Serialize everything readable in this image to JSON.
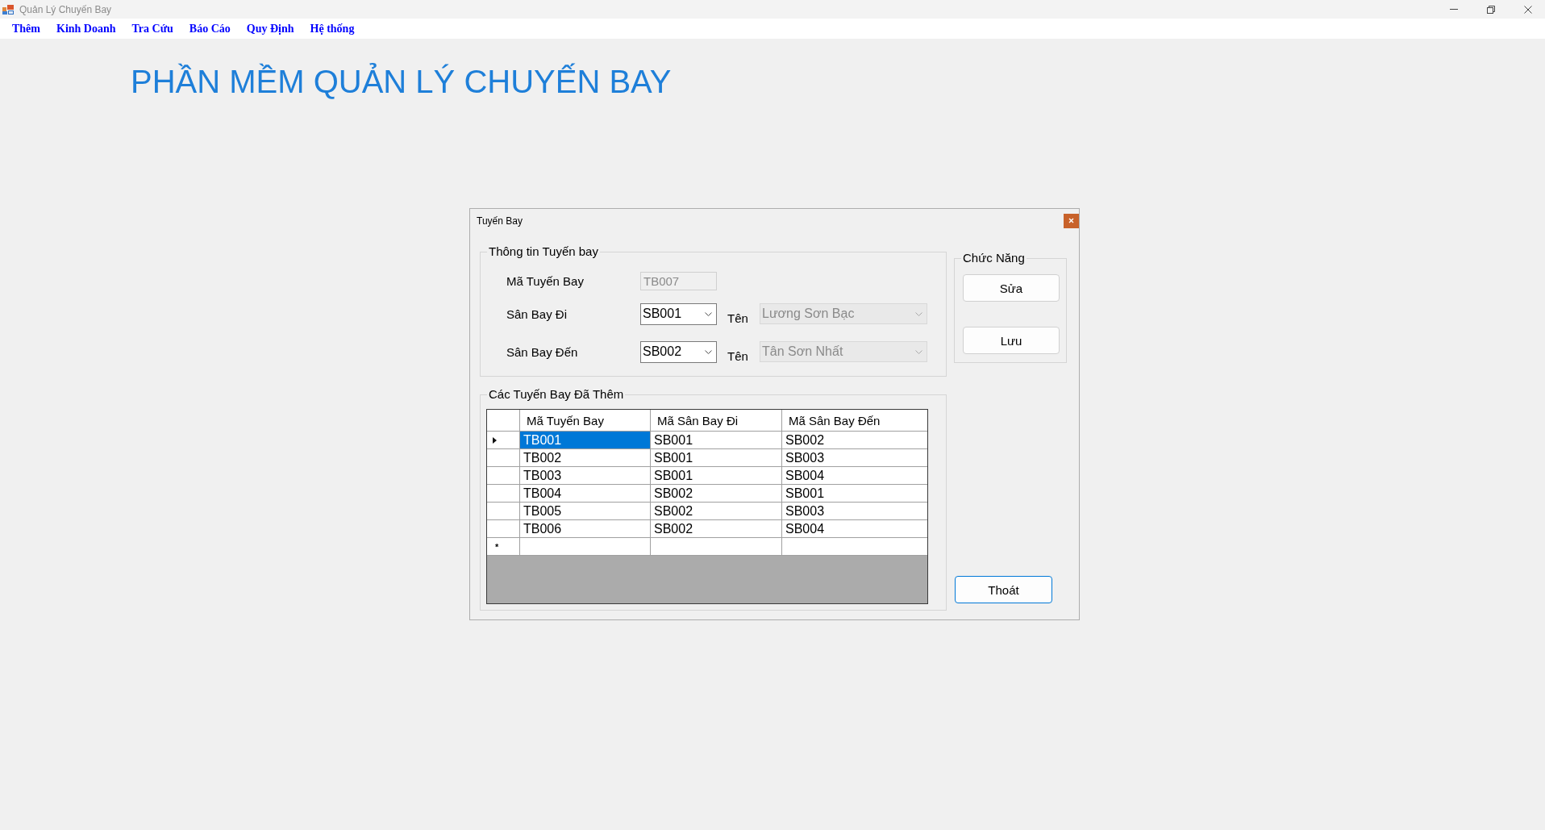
{
  "window": {
    "title": "Quản Lý Chuyến Bay"
  },
  "menu": [
    "Thêm",
    "Kinh Doanh",
    "Tra Cứu",
    "Báo Cáo",
    "Quy Định",
    "Hệ thống"
  ],
  "heading": "PHẦN MỀM QUẢN LÝ CHUYẾN BAY",
  "dialog": {
    "title": "Tuyến Bay",
    "info_group": {
      "title": "Thông tin Tuyến bay",
      "rows": [
        {
          "label": "Mã Tuyến Bay",
          "field": {
            "kind": "text",
            "value": "TB007",
            "disabled": true
          }
        },
        {
          "label": "Sân Bay Đi",
          "field": {
            "kind": "combo",
            "value": "SB001",
            "disabled": false
          },
          "name_label": "Tên",
          "name_field": {
            "kind": "combo",
            "value": "Lương Sơn Bạc",
            "disabled": true
          }
        },
        {
          "label": "Sân Bay Đến",
          "field": {
            "kind": "combo",
            "value": "SB002",
            "disabled": false
          },
          "name_label": "Tên",
          "name_field": {
            "kind": "combo",
            "value": "Tân Sơn Nhất",
            "disabled": true
          }
        }
      ]
    },
    "functions_group": {
      "title": "Chức Năng",
      "buttons": [
        {
          "label": "Sửa",
          "focused": false
        },
        {
          "label": "Lưu",
          "focused": false
        }
      ]
    },
    "routes_group": {
      "title": "Các Tuyến Bay Đã Thêm",
      "grid": {
        "columns": [
          "Mã Tuyến Bay",
          "Mã Sân Bay Đi",
          "Mã Sân Bay Đến"
        ],
        "rows": [
          {
            "cells": [
              "TB001",
              "SB001",
              "SB002"
            ],
            "selected": true
          },
          {
            "cells": [
              "TB002",
              "SB001",
              "SB003"
            ],
            "selected": false
          },
          {
            "cells": [
              "TB003",
              "SB001",
              "SB004"
            ],
            "selected": false
          },
          {
            "cells": [
              "TB004",
              "SB002",
              "SB001"
            ],
            "selected": false
          },
          {
            "cells": [
              "TB005",
              "SB002",
              "SB003"
            ],
            "selected": false
          },
          {
            "cells": [
              "TB006",
              "SB002",
              "SB004"
            ],
            "selected": false
          }
        ],
        "new_row_marker": "*"
      }
    },
    "exit_button": {
      "label": "Thoát",
      "focused": true
    }
  }
}
